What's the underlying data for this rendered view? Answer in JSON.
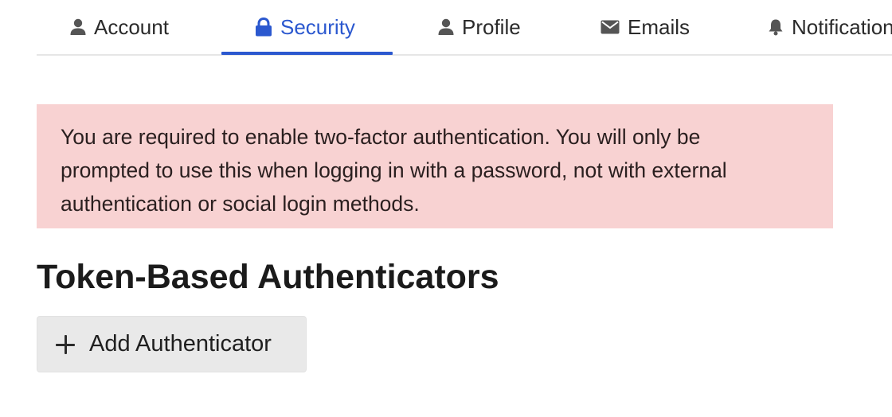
{
  "tabs": [
    {
      "label": "Account",
      "icon": "user-icon"
    },
    {
      "label": "Security",
      "icon": "lock-icon",
      "active": true
    },
    {
      "label": "Profile",
      "icon": "user-icon"
    },
    {
      "label": "Emails",
      "icon": "envelope-icon"
    },
    {
      "label": "Notifications",
      "icon": "bell-icon"
    }
  ],
  "alert": {
    "text": "You are required to enable two-factor authentication. You will only be prompted to use this when logging in with a password, not with external authentication or social login methods."
  },
  "section": {
    "title": "Token-Based Authenticators"
  },
  "add_button": {
    "label": "Add Authenticator",
    "icon": "plus-icon"
  },
  "colors": {
    "accent": "#2b58cf",
    "alert_bg": "#f8d2d2",
    "button_bg": "#e9e9e9"
  }
}
